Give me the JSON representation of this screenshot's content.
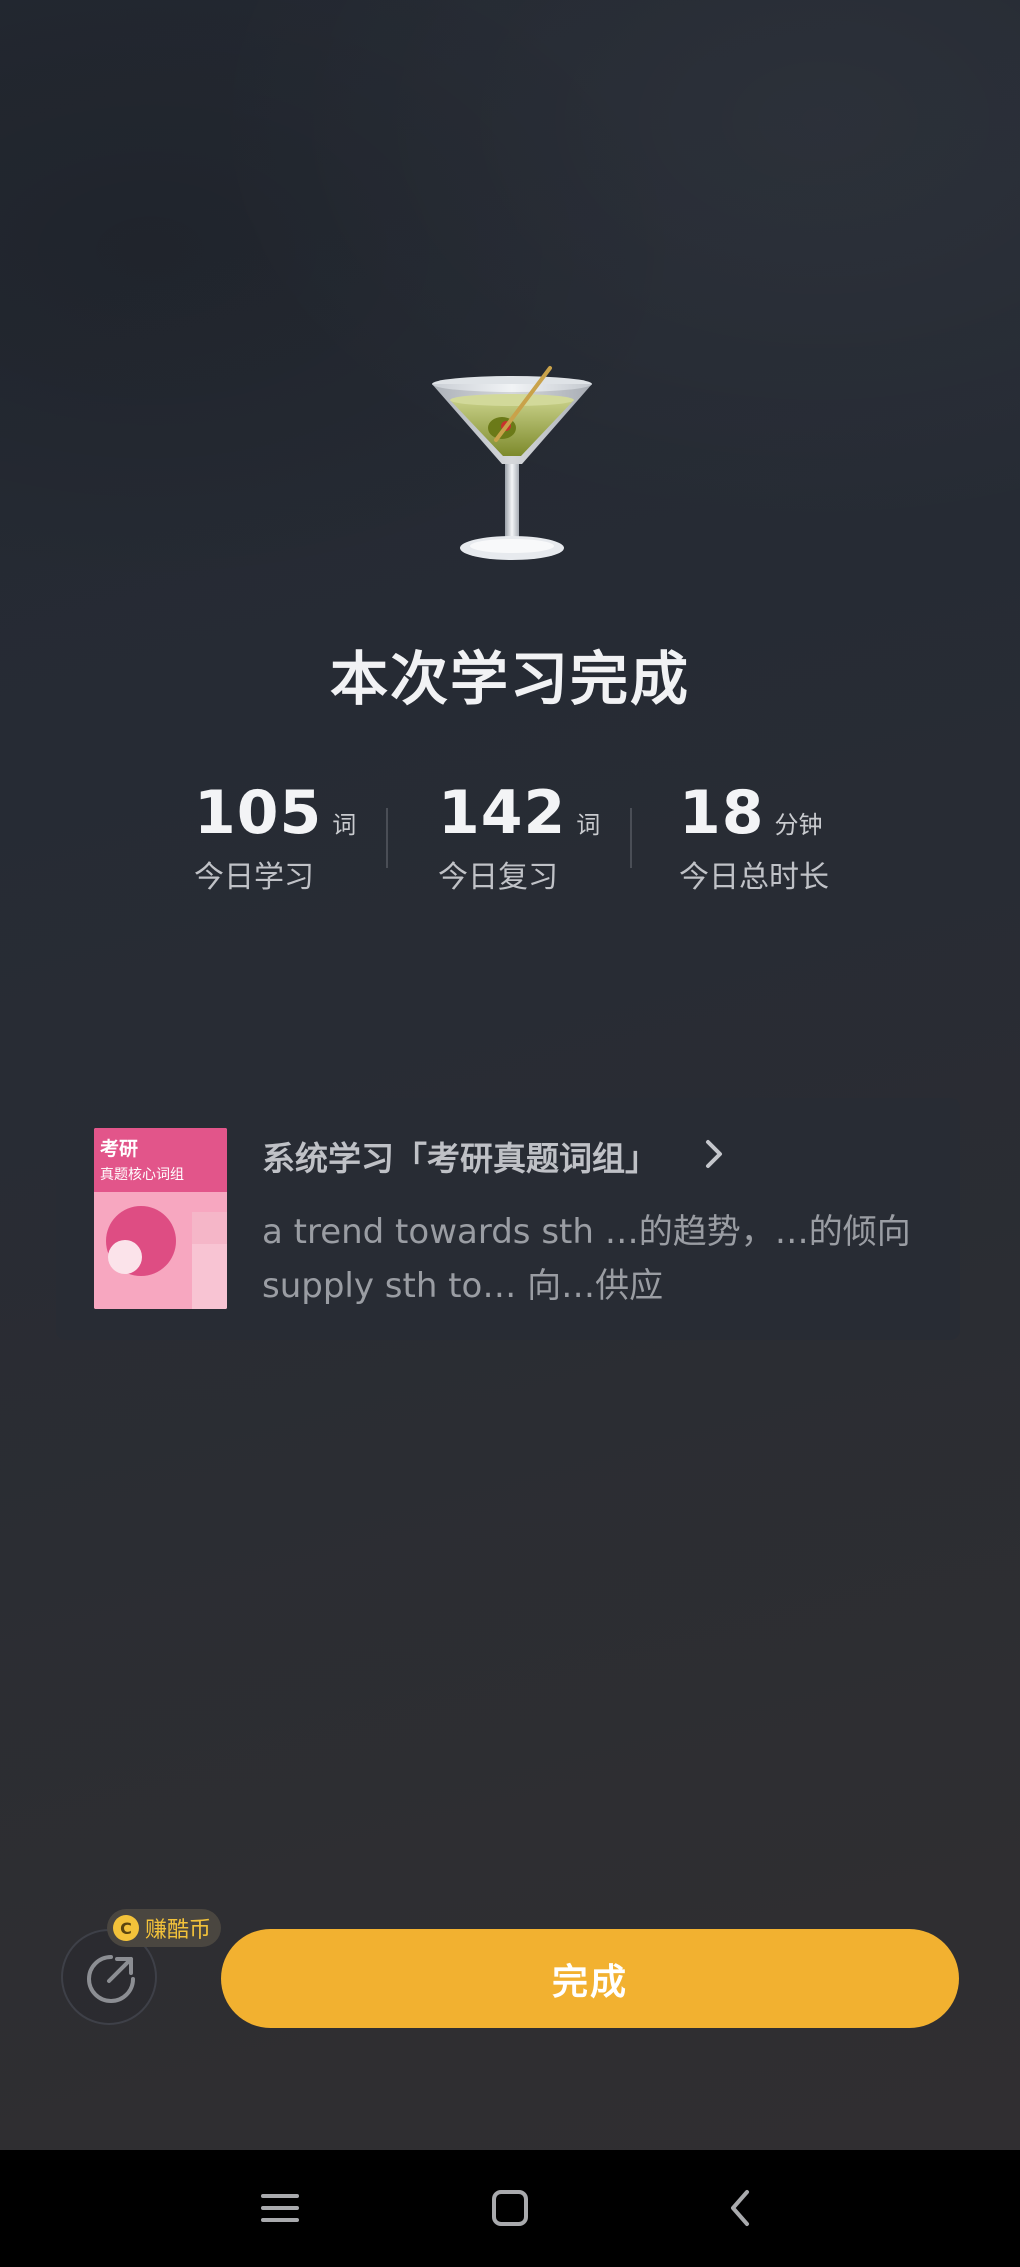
{
  "summary": {
    "title": "本次学习完成",
    "illustration": "cocktail-glass-icon"
  },
  "stats": [
    {
      "value": "105",
      "unit": "词",
      "label": "今日学习"
    },
    {
      "value": "142",
      "unit": "词",
      "label": "今日复习"
    },
    {
      "value": "18",
      "unit": "分钟",
      "label": "今日总时长"
    }
  ],
  "book": {
    "cover_title": "考研",
    "cover_subtitle": "真题核心词组",
    "title": "系统学习「考研真题词组」",
    "lines": [
      "a trend towards sth …的趋势，…的倾向",
      "supply sth to… 向…供应"
    ]
  },
  "actions": {
    "coin_symbol": "C",
    "coin_label": "赚酷币",
    "done_label": "完成"
  },
  "navbar": {
    "buttons": [
      "menu-icon",
      "home-icon",
      "back-icon"
    ]
  },
  "colors": {
    "accent": "#f2b130",
    "coin": "#f3c23a",
    "cover_pink": "#e2558a"
  }
}
